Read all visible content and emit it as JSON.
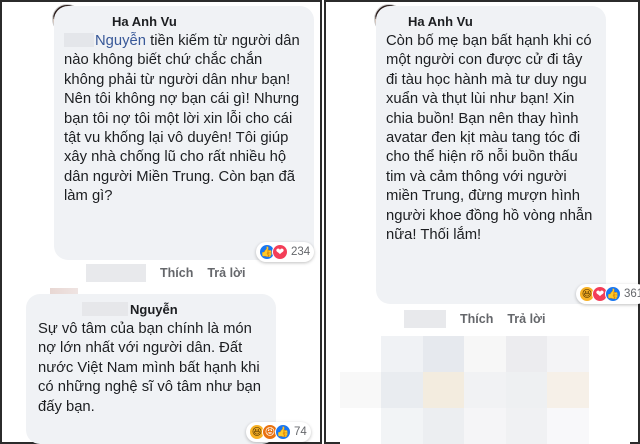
{
  "left_panel": {
    "comment1": {
      "author": "Ha Anh Vu",
      "mention": "Nguyễn",
      "text": " tiền kiếm từ người dân nào không biết chứ chắc chắn không phải từ người dân như bạn! Nên tôi không nợ bạn cái gì! Nhưng bạn tôi nợ tôi một lời xin lỗi cho cái tật vu khống lại vô duyên! Tôi giúp xây nhà chống lũ cho rất nhiều hộ dân người Miền Trung. Còn bạn đã làm gì?",
      "like_label": "Thích",
      "reply_label": "Trả lời",
      "reactions": [
        "like-icon",
        "love-icon"
      ],
      "reaction_count": "234"
    },
    "comment2": {
      "author": "Nguyễn",
      "text": "Sự vô tâm của bạn chính là món nợ lớn nhất với người dân. Đất nước Việt Nam mình bất hạnh khi có những nghệ sĩ vô tâm như bạn đấy bạn.",
      "reactions": [
        "haha-icon",
        "angry-icon",
        "like-icon"
      ],
      "reaction_count": "74"
    }
  },
  "right_panel": {
    "comment": {
      "author": "Ha Anh Vu",
      "text": "Còn bố mẹ bạn bất hạnh khi có một người con được cử đi tây đi tàu học hành mà tư duy ngu xuẩn và thụt lùi như bạn! Xin chia buồn! Bạn nên thay hình avatar đen kịt màu tang tóc đi cho thể hiện rõ nỗi buồn thấu tim và cảm thông với người miền Trung, đừng mượn hình người khoe đồng hồ vòng nhẫn nữa! Thối lắm!",
      "like_label": "Thích",
      "reply_label": "Trả lời",
      "reactions": [
        "haha-icon",
        "love-icon",
        "like-icon"
      ],
      "reaction_count": "361"
    }
  },
  "colors": {
    "bubble": "#f0f2f5",
    "mention": "#385898",
    "like": "#1877f2",
    "love": "#f33e58",
    "haha": "#f7b125",
    "angry": "#e9710f",
    "border": "#2b2b2b"
  }
}
